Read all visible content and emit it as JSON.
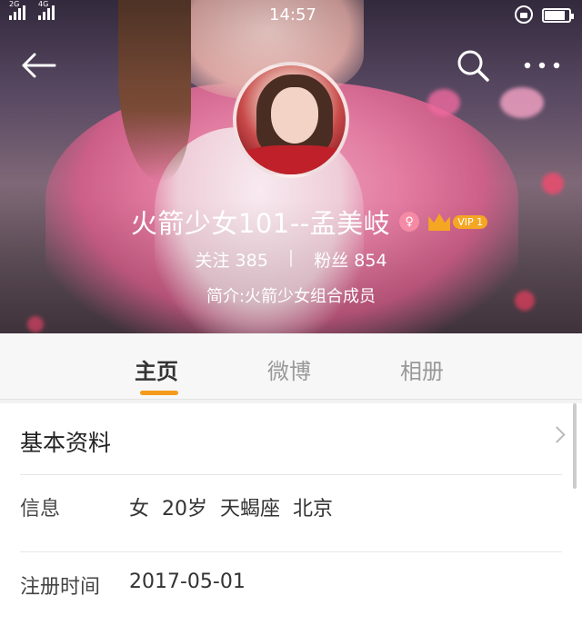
{
  "status_bar": {
    "signal_1_tag": "2G",
    "signal_2_tag": "4G",
    "time": "14:57",
    "battery_level": 0.85
  },
  "profile": {
    "name": "火箭少女101--孟美岐",
    "vip_label": "VIP 1",
    "following_label": "关注",
    "following_count": "385",
    "separator": "|",
    "followers_label": "粉丝",
    "followers_count": "854",
    "bio": "简介:火箭少女组合成员"
  },
  "tabs": [
    {
      "label": "主页",
      "active": true
    },
    {
      "label": "微博",
      "active": false
    },
    {
      "label": "相册",
      "active": false
    }
  ],
  "info": {
    "section_title": "基本资料",
    "basic_label": "信息",
    "basic_value": "女  20岁  天蝎座  北京",
    "register_label": "注册时间",
    "register_value": "2017-05-01"
  },
  "colors": {
    "accent": "#f59a1c",
    "vip": "#f5a623",
    "female": "#f58aa6"
  },
  "icons": [
    "back-arrow-icon",
    "search-icon",
    "more-icon",
    "female-icon",
    "crown-icon",
    "chevron-right-icon",
    "lock-rotation-icon",
    "battery-icon",
    "signal-icon"
  ]
}
